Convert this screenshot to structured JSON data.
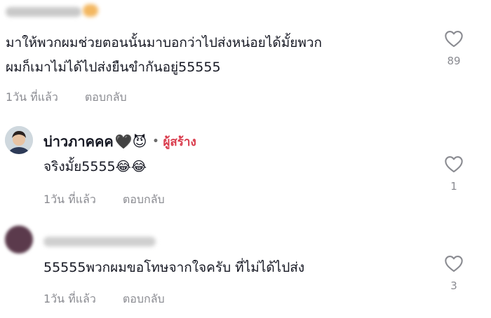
{
  "comments": [
    {
      "text_lines": [
        "มาให้พวกผมช่วยตอนนั้นมาบอกว่าไปส่งหน่อยได้มั้ยพวก",
        "ผมก็เมาไม่ได้ไปส่งยืนขำกันอยู่55555"
      ],
      "time": "1วัน ที่แล้ว",
      "reply_label": "ตอบกลับ",
      "likes": "89",
      "username_blurred": true
    },
    {
      "username": "บ่าวภาคคค",
      "username_emojis": "🖤😈",
      "creator_label": "ผู้สร้าง",
      "text": "จริงมั้ย5555😂😂",
      "time": "1วัน ที่แล้ว",
      "reply_label": "ตอบกลับ",
      "likes": "1"
    },
    {
      "username_blurred": true,
      "text": "55555พวกผมขอโทษจากใจครับ ที่ไม่ได้ไปส่ง",
      "time": "1วัน ที่แล้ว",
      "reply_label": "ตอบกลับ",
      "likes": "3"
    }
  ],
  "icons": {
    "like": "heart-outline-icon",
    "separator": "dot-separator"
  },
  "colors": {
    "creator": "#d93b4c",
    "meta": "#8a8b91",
    "text": "#161823"
  }
}
